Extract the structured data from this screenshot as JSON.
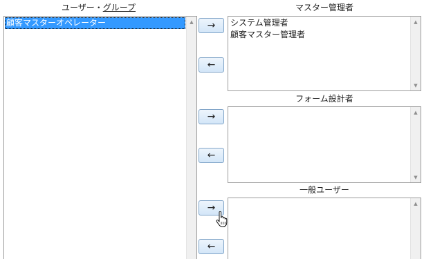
{
  "left_panel": {
    "title_prefix": "ユーザー・",
    "title_link": "グループ",
    "items": [
      {
        "label": "顧客マスターオペレーター",
        "selected": true
      }
    ]
  },
  "groups": [
    {
      "title": "マスター管理者",
      "add_label": "→",
      "remove_label": "←",
      "members": [
        "システム管理者",
        "顧客マスター管理者"
      ]
    },
    {
      "title": "フォーム設計者",
      "add_label": "→",
      "remove_label": "←",
      "members": []
    },
    {
      "title": "一般ユーザー",
      "add_label": "→",
      "remove_label": "←",
      "members": []
    }
  ],
  "scroll_up_icon": "scroll-up-arrow-icon",
  "scroll_down_icon": "scroll-down-arrow-icon",
  "cursor_icon": "hand-pointer-icon"
}
